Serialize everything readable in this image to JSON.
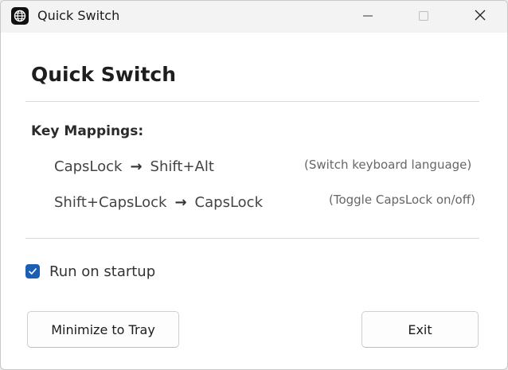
{
  "window": {
    "title": "Quick Switch",
    "icon": "globe-icon",
    "controls": [
      "minimize-icon",
      "maximize-icon",
      "close-icon"
    ]
  },
  "main": {
    "heading": "Quick Switch",
    "mappings_title": "Key Mappings:",
    "mappings": [
      {
        "from": "CapsLock",
        "arrow": "→",
        "to": "Shift+Alt",
        "note": "(Switch keyboard language)"
      },
      {
        "from": "Shift+CapsLock",
        "arrow": "→",
        "to": "CapsLock",
        "note": "(Toggle CapsLock on/off)"
      }
    ],
    "startup": {
      "label": "Run on startup",
      "checked": true
    }
  },
  "buttons": {
    "minimize_to_tray": "Minimize to Tray",
    "exit": "Exit"
  },
  "colors": {
    "accent": "#1a5fb4",
    "titlebar": "#f3f3f3",
    "background": "#ffffff"
  }
}
